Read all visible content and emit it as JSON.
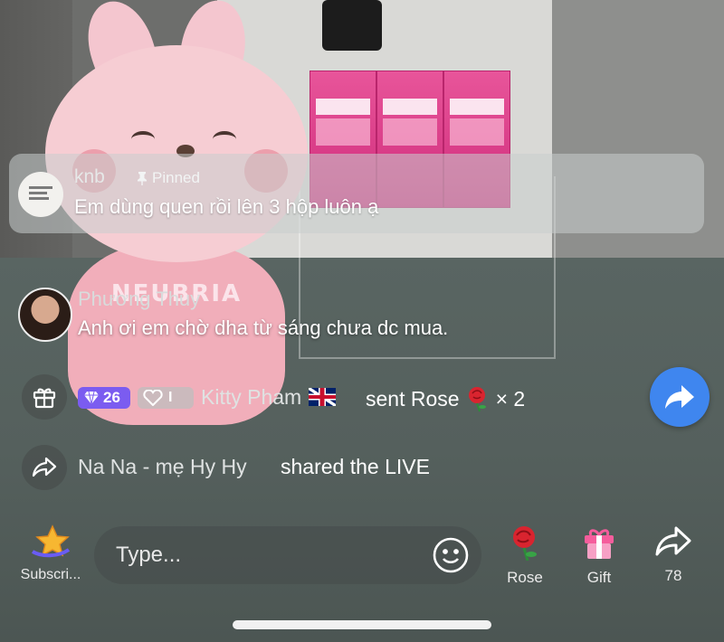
{
  "pinned": {
    "username": "knb",
    "pinned_label": "Pinned",
    "message": "Em dùng quen rồi lên 3 hộp luôn ạ"
  },
  "comment": {
    "username": "Phương Thuy",
    "message": "Anh ơi em chờ dha từ sáng chưa dc mua."
  },
  "gift_event": {
    "diamond_level": "26",
    "heart_level": "I",
    "username": "Kitty Pham",
    "action": "sent Rose",
    "count": "× 2"
  },
  "share_event": {
    "username": "Na Na - mẹ Hy Hy",
    "action": "shared the LIVE"
  },
  "background": {
    "plush_shirt_text": "NEUBRIA"
  },
  "bottom_bar": {
    "subscribe_label": "Subscri...",
    "input_placeholder": "Type...",
    "rose_label": "Rose",
    "gift_label": "Gift",
    "share_count": "78"
  },
  "colors": {
    "share_button": "#3f86ef",
    "diamond_badge": "#7b5cf0"
  },
  "icons": [
    "gift-box-icon",
    "diamond-icon",
    "heart-icon",
    "uk-flag-icon",
    "rose-icon",
    "share-arrow-icon",
    "star-icon",
    "emoji-icon",
    "pin-icon"
  ]
}
